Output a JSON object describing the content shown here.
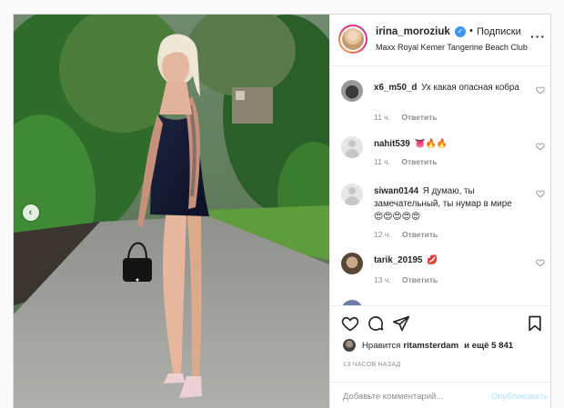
{
  "post": {
    "username": "irina_moroziuk",
    "separator": "•",
    "follow_label": "Подписки",
    "location": "Maxx Royal Kemer Tangerine Beach Club",
    "more_icon": "more-horizontal-icon",
    "verified_icon": "verified-badge-icon"
  },
  "comments": [
    {
      "username": "x6_m50_d",
      "text": "Ух какая опасная кобра",
      "time": "11 ч.",
      "reply_label": "Ответить"
    },
    {
      "username": "nahit539",
      "text": "👅🔥🔥",
      "time": "11 ч.",
      "reply_label": "Ответить"
    },
    {
      "username": "siwan0144",
      "text": "Я думаю, ты замечательный, ты нумар в мире😍😍😍😍😍",
      "time": "12 ч.",
      "reply_label": "Ответить"
    },
    {
      "username": "tarik_20195",
      "text": "💋",
      "time": "13 ч.",
      "reply_label": "Ответить"
    }
  ],
  "actions": {
    "likes_prefix": "Нравится",
    "likes_user": "ritamsterdam",
    "likes_suffix": "и ещё 5 841",
    "timestamp": "13 ЧАСОВ НАЗАД"
  },
  "add_comment": {
    "placeholder": "Добавьте комментарий...",
    "publish_label": "Опубликовать"
  },
  "colors": {
    "accent_blue": "#3897f0",
    "publish_disabled": "#b2dffc",
    "muted_text": "#8e8e8e"
  }
}
